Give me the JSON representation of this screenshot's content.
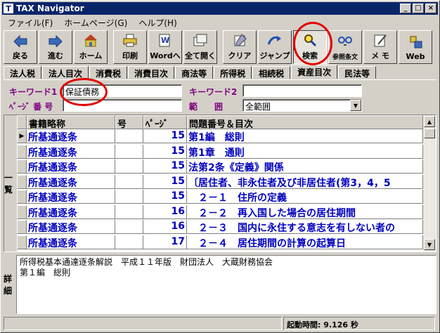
{
  "window": {
    "title": "TAX Navigator",
    "app_icon": "T"
  },
  "menu": [
    {
      "label": "ファイル(F)"
    },
    {
      "label": "ホームページ(G)"
    },
    {
      "label": "ヘルプ(H)"
    }
  ],
  "toolbar": [
    {
      "label": "戻る",
      "icon": "back-icon"
    },
    {
      "label": "進む",
      "icon": "forward-icon"
    },
    {
      "label": "ホーム",
      "icon": "home-icon"
    },
    {
      "label": "印刷",
      "icon": "print-icon"
    },
    {
      "label": "Wordへ",
      "icon": "word-icon"
    },
    {
      "label": "全て開く",
      "icon": "open-all-icon"
    },
    {
      "label": "クリア",
      "icon": "clear-icon"
    },
    {
      "label": "ジャンプ",
      "icon": "jump-icon"
    },
    {
      "label": "検索",
      "icon": "search-icon"
    },
    {
      "label": "参照条文",
      "icon": "reference-icon"
    },
    {
      "label": "メ モ",
      "icon": "memo-icon"
    },
    {
      "label": "Web",
      "icon": "web-icon"
    }
  ],
  "tabs": [
    {
      "label": "法人税"
    },
    {
      "label": "法人目次"
    },
    {
      "label": "消費税"
    },
    {
      "label": "消費目次"
    },
    {
      "label": "商法等"
    },
    {
      "label": "所得税"
    },
    {
      "label": "相続税"
    },
    {
      "label": "資産目次"
    },
    {
      "label": "民法等"
    }
  ],
  "search": {
    "keyword1_label": "キーワード1",
    "keyword1_value": "保証債務",
    "keyword2_label": "キーワード2",
    "keyword2_value": "",
    "page_label": "ﾍﾟｰｼﾞ 番 号",
    "page_value": "",
    "range_label": "範　　囲",
    "range_value": "全範囲"
  },
  "grid": {
    "side_label": "一覧",
    "columns": [
      "書籍略称",
      "号",
      "ﾍﾟｰｼﾞ",
      "問題番号＆目次"
    ],
    "rows": [
      {
        "book": "所基通逐条",
        "no": "",
        "page": "15",
        "title": "第1編　総則"
      },
      {
        "book": "所基通逐条",
        "no": "",
        "page": "15",
        "title": "第1章　通則"
      },
      {
        "book": "所基通逐条",
        "no": "",
        "page": "15",
        "title": "法第2条《定義》関係"
      },
      {
        "book": "所基通逐条",
        "no": "",
        "page": "15",
        "title": "〔居住者、非永住者及び非居住者(第3，4，5"
      },
      {
        "book": "所基通逐条",
        "no": "",
        "page": "15",
        "title": "　２－１　住所の定義"
      },
      {
        "book": "所基通逐条",
        "no": "",
        "page": "16",
        "title": "　２－２　再入国した場合の居住期間"
      },
      {
        "book": "所基通逐条",
        "no": "",
        "page": "16",
        "title": "　２－３　国内に永住する意志を有しない者の"
      },
      {
        "book": "所基通逐条",
        "no": "",
        "page": "17",
        "title": "　２－４　居住期間の計算の起算日"
      }
    ]
  },
  "detail": {
    "side_label": "詳細",
    "line1": "所得税基本通達逐条解説　平成１１年版　財団法人　大蔵財務協会",
    "line2": "第１編　総則"
  },
  "status": {
    "startup_time": "起動時間:  9.126 秒"
  },
  "colors": {
    "annotation_red": "#e00000",
    "link_blue": "#0000c0",
    "label_purple": "#800080"
  }
}
